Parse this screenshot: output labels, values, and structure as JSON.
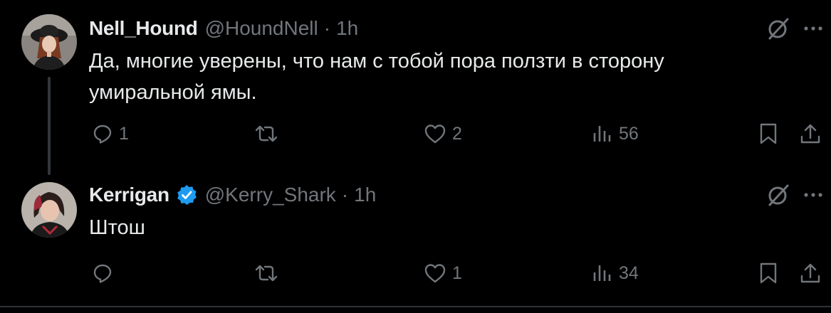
{
  "tweets": [
    {
      "author": {
        "display_name": "Nell_Hound",
        "handle": "@HoundNell",
        "verified": false
      },
      "separator": "·",
      "time": "1h",
      "text": "Да, многие уверены, что нам с тобой пора ползти в сторону умиральной ямы.",
      "stats": {
        "replies": "1",
        "retweets": "",
        "likes": "2",
        "views": "56"
      }
    },
    {
      "author": {
        "display_name": "Kerrigan",
        "handle": "@Kerry_Shark",
        "verified": true
      },
      "separator": "·",
      "time": "1h",
      "text": "Штош",
      "stats": {
        "replies": "",
        "retweets": "",
        "likes": "1",
        "views": "34"
      }
    }
  ],
  "colors": {
    "background": "#000000",
    "text_primary": "#e7e9ea",
    "text_secondary": "#71767b",
    "verified_blue": "#1d9bf0",
    "thread_line": "#333639"
  },
  "icons": [
    "reply-icon",
    "retweet-icon",
    "like-icon",
    "views-icon",
    "bookmark-icon",
    "share-icon",
    "grok-icon",
    "more-icon",
    "verified-badge-icon"
  ]
}
